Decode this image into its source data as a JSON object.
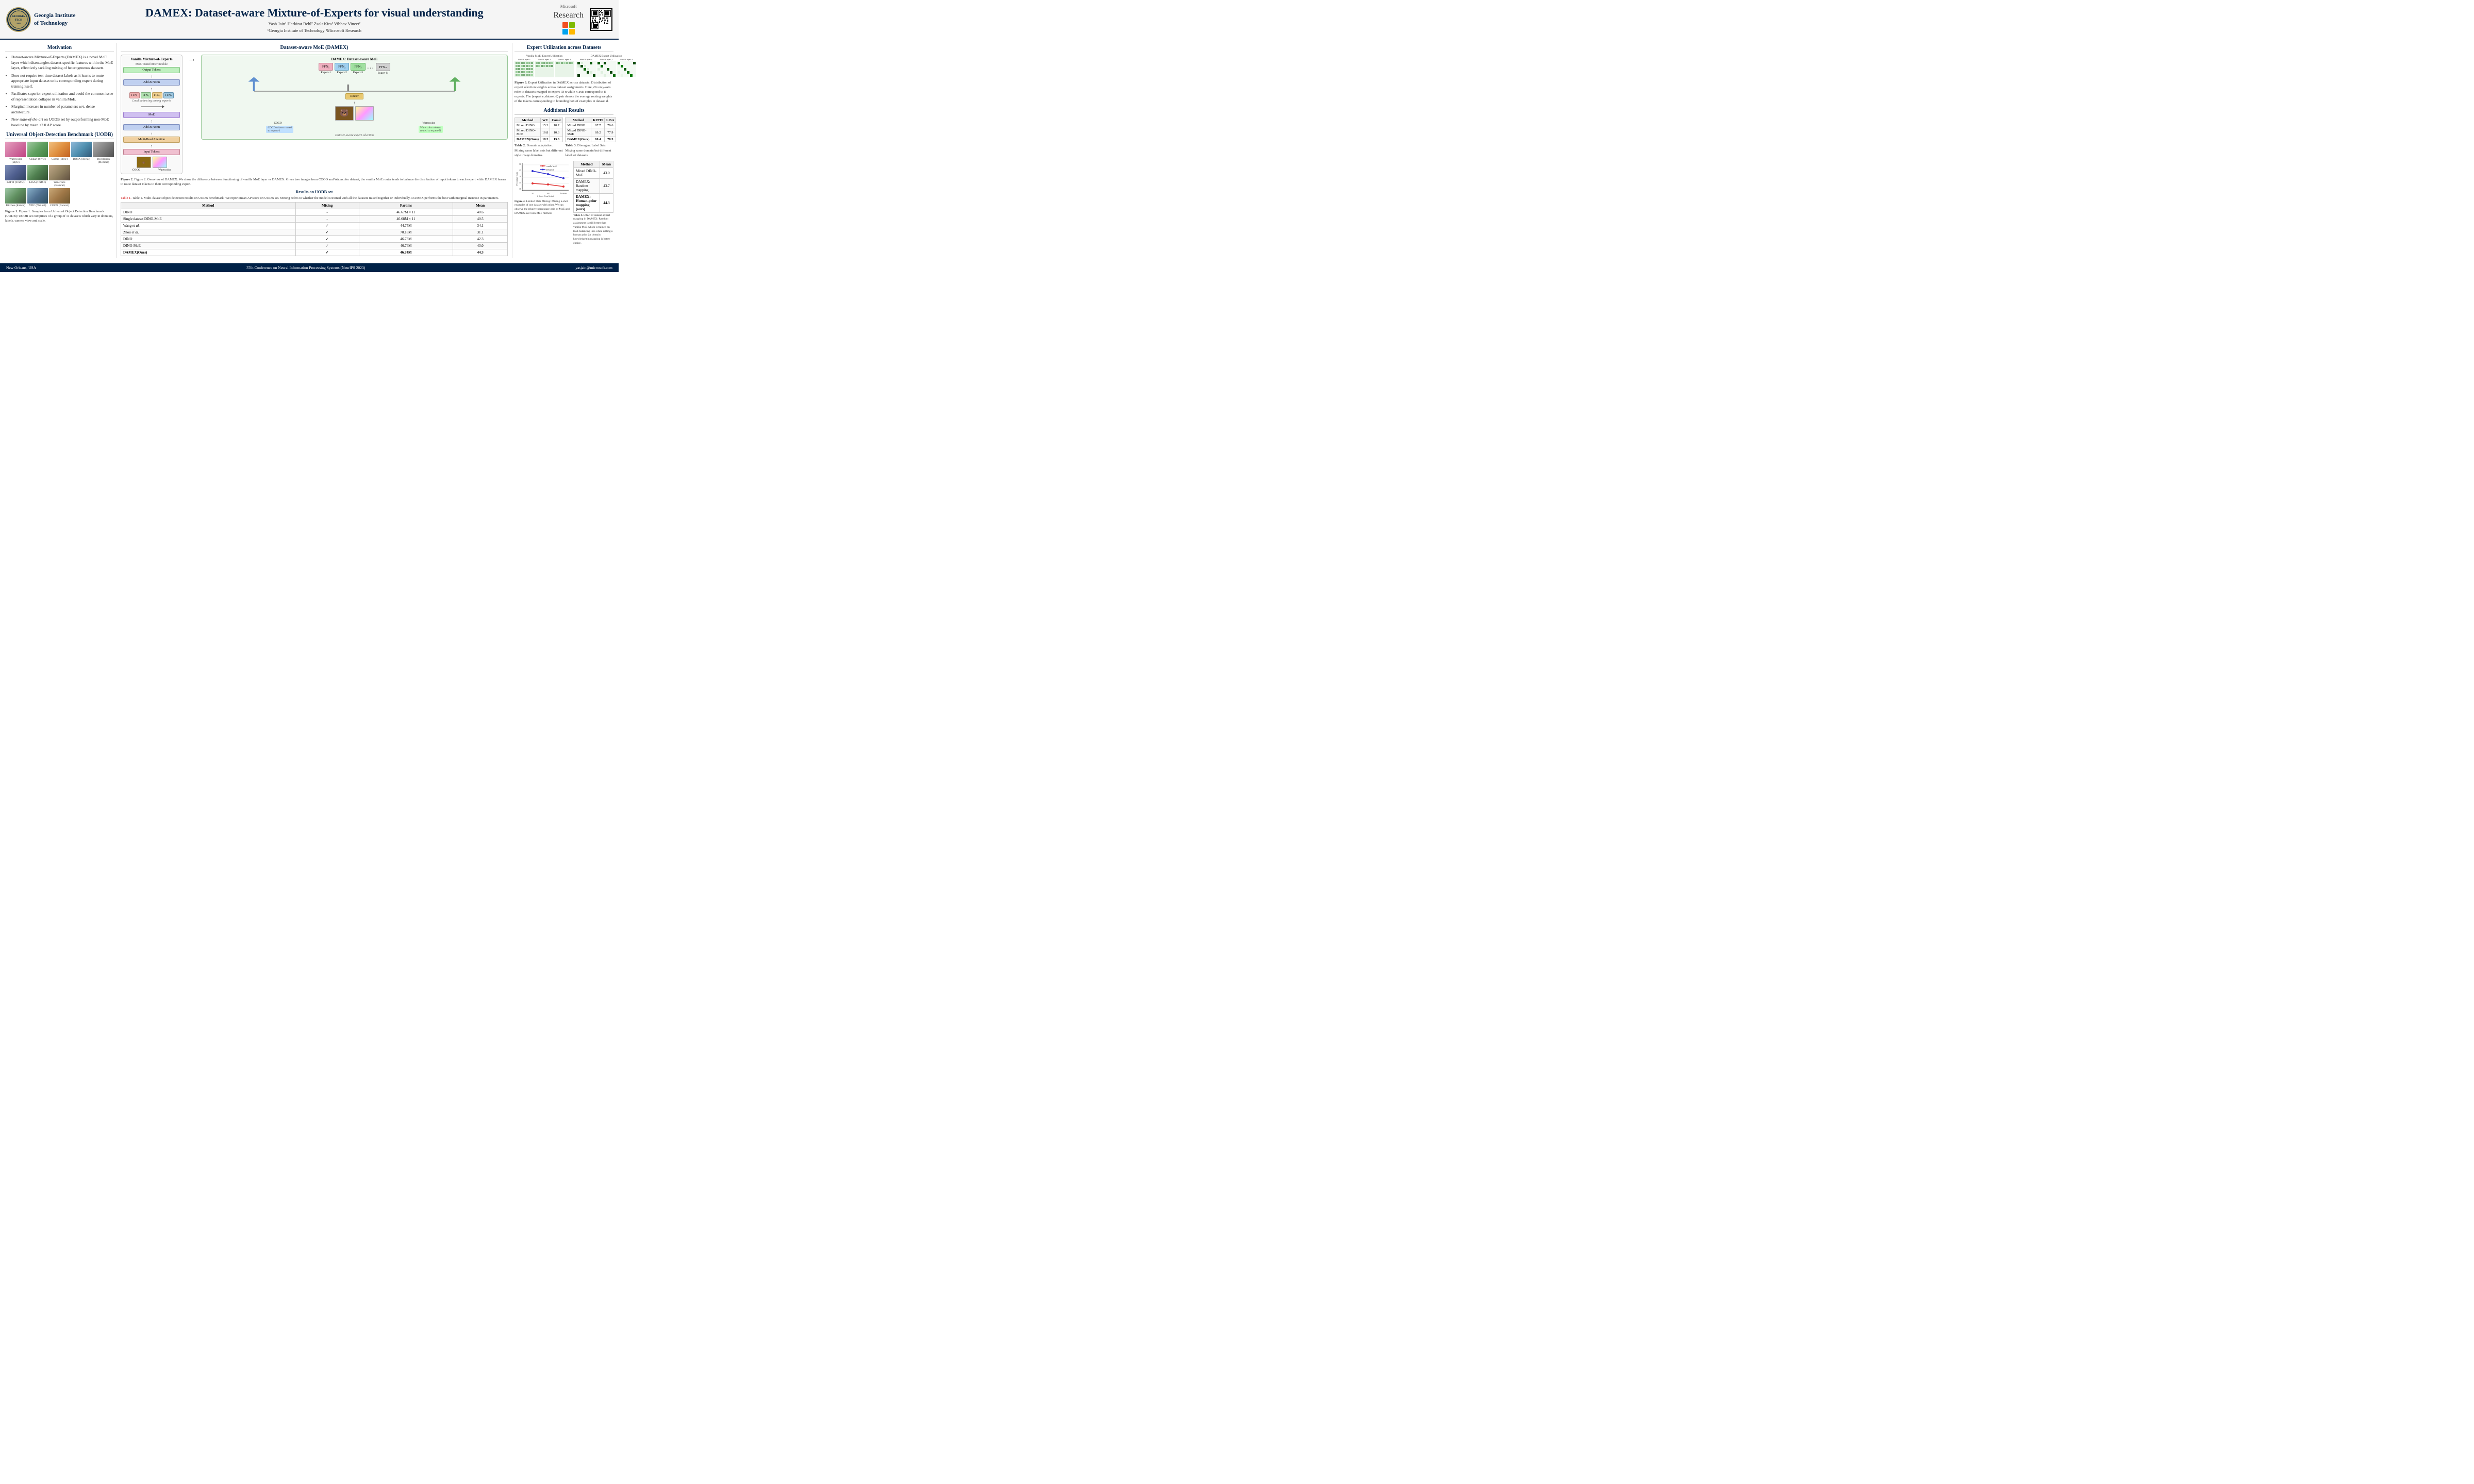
{
  "header": {
    "gt_name": "Georgia Institute\nof Technology",
    "title": "DAMEX: Dataset-aware Mixture-of-Experts for visual understanding",
    "authors": "Yash Jain¹    Harkirat Behl²    Zsolt Kira¹    Vibhav Vineet²",
    "affiliations": "¹Georgia Institute of Technology    ²Microsoft Research",
    "ms_label": "Microsoft",
    "ms_name": "Research"
  },
  "motivation": {
    "title": "Motivation",
    "points": [
      "Dataset-aware Mixture-of-Experts (DAMEX) is a novel MoE layer which disentangles dataset-specific features within the MoE layer, effectively tackling mixing of heterogeneous datasets.",
      "Does not require test-time dataset labels as it learns to route appropriate input dataset to its corresponding expert during training itself.",
      "Facilitates superior expert utilization and avoid the common issue of representation collapse in vanilla MoE.",
      "Marginal increase in number of parameters wrt. dense architecture.",
      "New state-of-the-art on UODB set by outperforming non-MoE baseline by mean +2.0 AP score."
    ]
  },
  "uodb": {
    "title": "Universal Object-Detection Benchmark (UODB)",
    "datasets": [
      {
        "name": "Watercolor (Style)",
        "color": "#d4a"
      },
      {
        "name": "Clipart (Style)",
        "color": "#8b4"
      },
      {
        "name": "Comic (Style)",
        "color": "#e94"
      },
      {
        "name": "DOTA (Aerial)",
        "color": "#49c"
      },
      {
        "name": "Deeplesion (Medical)",
        "color": "#888"
      },
      {
        "name": "KITTI (Traffic)",
        "color": "#69b"
      },
      {
        "name": "LISA (Traffic)",
        "color": "#7a6"
      },
      {
        "name": "Widerface (Natural)",
        "color": "#a87"
      },
      {
        "name": "Kitchen (Indoor)",
        "color": "#8a6"
      },
      {
        "name": "VDC (Natural)",
        "color": "#6a9"
      },
      {
        "name": "COCO (Natural)",
        "color": "#b86"
      }
    ],
    "caption": "Figure 1. Samples from Universal Object Detection Benchmark (UODB): UODB set comprises of a group of 11 datasets which vary in domains, labels, camera view and scale."
  },
  "diagram": {
    "vanilla_title": "Vanilla Mixture-of-Experts",
    "damex_title": "DAMEX: Dataset-aware MoE",
    "load_balancing": "Load balancing among experts",
    "dataset_aware": "Dataset-aware expert selection",
    "module_output": "Output Tokens",
    "module_moe_transformer": "MoE Transformer module",
    "module_add_norm1": "Add & Norm",
    "module_moe": "MoE",
    "module_add_norm2": "Add & Norm",
    "module_multihead": "Multi-Head\nAttention",
    "module_input": "Input Tokens",
    "router_label": "Router",
    "coco_label": "COCO",
    "watercolor_label": "Watercolor",
    "coco_token_label": "COCO tokens routed\nto expert-1",
    "watercolor_token_label": "Watercolor tokens\nrouted to expert-N",
    "caption": "Figure 2. Overview of DAMEX: We show the difference between functioning of vanilla MoE layer vs DAMEX. Given two images from COCO and Watercolor dataset, the vanilla MoE router tends to balance the distribution of input tokens to each expert while DAMEX learns to route dataset tokens to their corresponding expert."
  },
  "results": {
    "title": "Results on UODB set",
    "caption": "Table 1. Multi-dataset object detection results on UODB benchmark: We report mean AP score on UODB set. Mixing refers to whether the model is trained with all the datasets mixed together or individually. DAMEX performs the best with marginal increase in parameters.",
    "columns": [
      "Method",
      "Mixing",
      "Params",
      "Mean"
    ],
    "rows": [
      {
        "method": "DINO",
        "mixing": "-",
        "params": "46.67M × 11",
        "mean": "40.6",
        "bold": false,
        "divider": false
      },
      {
        "method": "Single dataset DINO-MoE",
        "mixing": "-",
        "params": "46.68M × 11",
        "mean": "40.5",
        "bold": false,
        "divider": false
      },
      {
        "method": "Wang et al.",
        "mixing": "✓",
        "params": "44.75M",
        "mean": "34.1",
        "bold": false,
        "divider": true
      },
      {
        "method": "Zhou et al.",
        "mixing": "✓",
        "params": "70.18M",
        "mean": "31.1",
        "bold": false,
        "divider": false
      },
      {
        "method": "DINO",
        "mixing": "✓",
        "params": "46.73M",
        "mean": "42.3",
        "bold": false,
        "divider": false
      },
      {
        "method": "DINO-MoE",
        "mixing": "✓",
        "params": "46.74M",
        "mean": "43.0",
        "bold": false,
        "divider": false
      },
      {
        "method": "DAMEX(Ours)",
        "mixing": "✓",
        "params": "46.74M",
        "mean": "44.3",
        "bold": true,
        "divider": false
      }
    ]
  },
  "expert_util": {
    "title": "Expert Utilization across Datasets",
    "vanilla_label": "Vanilla MoE: Expert Utilization",
    "damex_label": "DAMEX Expert Utilization",
    "layers": [
      "MoE Layer 1",
      "MoE Layer 2",
      "MoE Layer 3"
    ],
    "caption": "Figure 3. Expert Utilization in DAMEX across datasets: Distribution of expert selection weights across dataset assignments. Here, Dn on y-axis refer to datasets mapped to expert ID n while x-axis correspond to 8 experts. The (expert e, dataset d) pair denote the average routing weights of the tokens corresponding to bounding box of examples in dataset d."
  },
  "additional": {
    "title": "Additional Results",
    "table2": {
      "caption": "Table 2. Domain adaptation: Mixing same label sets but different style image domains.",
      "columns": [
        "Method",
        "WC",
        "Comic"
      ],
      "rows": [
        {
          "method": "Mixed DINO",
          "wc": "15.3",
          "comic": "10.7",
          "bold": false
        },
        {
          "method": "Mixed DINO-MoE",
          "wc": "16.8",
          "comic": "10.6",
          "bold": false
        },
        {
          "method": "DAMEX(Ours)",
          "wc": "18.2",
          "comic": "13.6",
          "bold": true
        }
      ]
    },
    "table3": {
      "caption": "Table 3. Divergent Label Sets: Mixing same domain but different label set datasets",
      "columns": [
        "Method",
        "KITTI",
        "LISA"
      ],
      "rows": [
        {
          "method": "Mixed DINO",
          "c1": "67.7",
          "c2": "76.6",
          "bold": false
        },
        {
          "method": "Mixed DINO-MoE",
          "c1": "69.2",
          "c2": "77.9",
          "bold": false
        },
        {
          "method": "DAMEX(Ours)",
          "c1": "69.4",
          "c2": "78.5",
          "bold": true
        }
      ]
    },
    "table4": {
      "caption": "Table 4. Effect of dataset-expert mapping in DAMEX: Random assignment is still better than vanilla MoE which is trained on load-balancing loss while adding a human prior (or domain knowledge) in mapping is better choice.",
      "columns": [
        "Method",
        "Mean"
      ],
      "rows": [
        {
          "method": "Mixed DINO-MoE",
          "mean": "43.0",
          "bold": false
        },
        {
          "method": "DAMEX: Random mapping",
          "mean": "43.7",
          "bold": false
        },
        {
          "method": "DAMEX: Human-prior mapping (ours)",
          "mean": "44.3",
          "bold": true
        }
      ]
    },
    "chart": {
      "title": "Figure 4. Limited Data Mixing: Mixing n-shot examples of one dataset with other. We can observe the relative percentage gain of MoE and DAMEX over non-MoE method.",
      "y_label": "Percentage Gain",
      "x_label": "# Shots (Log Scale)",
      "legend": [
        "vanilla MoE",
        "DAMEX"
      ],
      "legend_colors": [
        "#e03030",
        "#3030d0"
      ],
      "data_vanilla": [
        11,
        12,
        10,
        9
      ],
      "data_damex": [
        21,
        18,
        16,
        13
      ],
      "x_ticks": [
        "50",
        "100",
        "full dataset"
      ]
    }
  },
  "footer": {
    "location": "New Orleans, USA",
    "conference": "37th Conference on Neural Information Processing Systems (NeurIPS 2023)",
    "email": "yasjain@microsoft.com"
  }
}
